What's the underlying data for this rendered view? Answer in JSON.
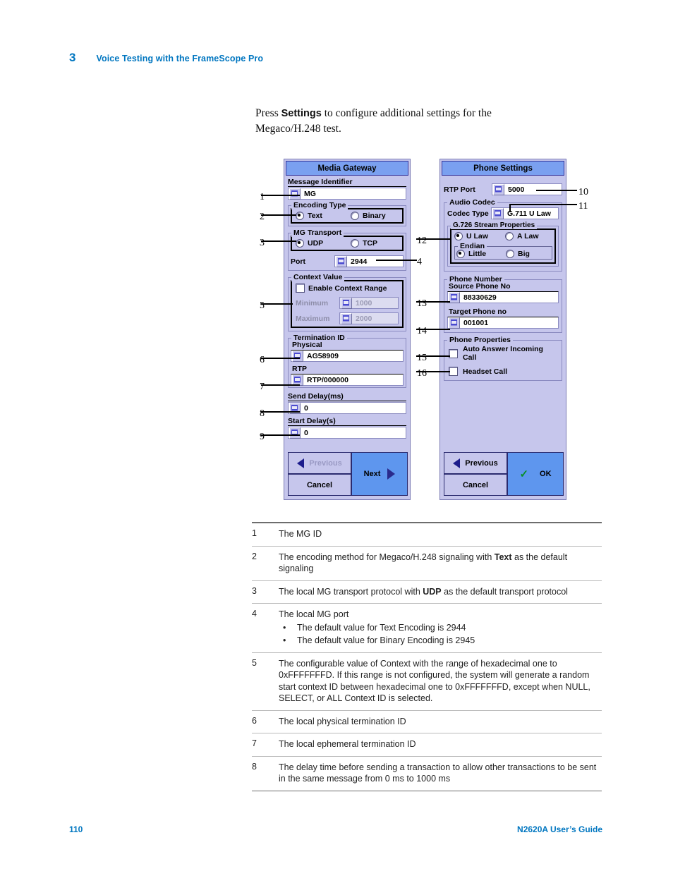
{
  "chapter": {
    "number": "3",
    "title": "Voice Testing with the FrameScope Pro"
  },
  "intro": {
    "before": "Press ",
    "bold": "Settings",
    "after": " to configure additional settings for the Megaco/H.248 test."
  },
  "footer": {
    "page": "110",
    "guide": "N2620A User’s Guide"
  },
  "colors": {
    "brand_blue": "#0076c0",
    "title_bar": "#7aa0f0",
    "dialog_bg": "#c6c6ec",
    "primary_button": "#5e96ee",
    "check_green": "#0a8f2a"
  },
  "media_gateway": {
    "title": "Media Gateway",
    "message_identifier": {
      "label": "Message Identifier",
      "value": "MG"
    },
    "encoding_type": {
      "legend": "Encoding Type",
      "options": [
        "Text",
        "Binary"
      ],
      "selected": "Text"
    },
    "mg_transport": {
      "legend": "MG Transport",
      "options": [
        "UDP",
        "TCP"
      ],
      "selected": "UDP",
      "port_label": "Port",
      "port_value": "2944"
    },
    "context_value": {
      "legend": "Context Value",
      "enable_label": "Enable Context Range",
      "enabled": false,
      "minimum_label": "Minimum",
      "minimum_value": "1000",
      "maximum_label": "Maximum",
      "maximum_value": "2000"
    },
    "termination_id": {
      "legend": "Termination ID",
      "physical_label": "Physical",
      "physical_value": "AG58909",
      "rtp_label": "RTP",
      "rtp_value": "RTP/000000"
    },
    "send_delay": {
      "label": "Send Delay(ms)",
      "value": "0"
    },
    "start_delay": {
      "label": "Start Delay(s)",
      "value": "0"
    },
    "buttons": {
      "previous": "Previous",
      "cancel": "Cancel",
      "next": "Next"
    }
  },
  "phone_settings": {
    "title": "Phone Settings",
    "rtp_port": {
      "label": "RTP Port",
      "value": "5000"
    },
    "audio_codec": {
      "legend": "Audio Codec",
      "codec_type_label": "Codec Type",
      "codec_type_value": "G.711 U Law",
      "g726": {
        "legend": "G.726 Stream Properties",
        "law_options": [
          "U Law",
          "A Law"
        ],
        "law_selected": "U Law",
        "endian_legend": "Endian",
        "endian_options": [
          "Little",
          "Big"
        ],
        "endian_selected": "Little"
      }
    },
    "phone_number": {
      "legend": "Phone Number",
      "source_label": "Source Phone No",
      "source_value": "88330629",
      "target_label": "Target Phone no",
      "target_value": "001001"
    },
    "phone_properties": {
      "legend": "Phone Properties",
      "auto_answer_label": "Auto Answer Incoming Call",
      "auto_answer_checked": false,
      "headset_label": "Headset Call",
      "headset_checked": false
    },
    "buttons": {
      "previous": "Previous",
      "cancel": "Cancel",
      "ok": "OK"
    }
  },
  "callouts": [
    "1",
    "2",
    "3",
    "4",
    "5",
    "6",
    "7",
    "8",
    "9",
    "10",
    "11",
    "12",
    "13",
    "14",
    "15",
    "16"
  ],
  "definitions": [
    {
      "num": "1",
      "text": "The MG ID",
      "bold": null,
      "sub": []
    },
    {
      "num": "2",
      "pre": "The encoding method for Megaco/H.248 signaling with ",
      "bold": "Text",
      "post": " as the default signaling",
      "sub": []
    },
    {
      "num": "3",
      "pre": "The local MG transport protocol with ",
      "bold": "UDP",
      "post": " as the default transport protocol",
      "sub": []
    },
    {
      "num": "4",
      "text": "The local MG port",
      "sub": [
        "The default value for Text Encoding is 2944",
        "The default value for Binary Encoding is 2945"
      ]
    },
    {
      "num": "5",
      "text": "The configurable value of Context with the range of hexadecimal one to 0xFFFFFFFD. If this range is not configured, the system will generate a random start context ID between hexadecimal one to 0xFFFFFFFD, except when NULL, SELECT, or ALL Context ID is selected.",
      "sub": []
    },
    {
      "num": "6",
      "text": "The local physical termination ID",
      "sub": []
    },
    {
      "num": "7",
      "text": "The local ephemeral termination ID",
      "sub": []
    },
    {
      "num": "8",
      "text": "The delay time before sending a transaction to allow other transactions to be sent in the same message from 0 ms to 1000 ms",
      "sub": []
    }
  ]
}
